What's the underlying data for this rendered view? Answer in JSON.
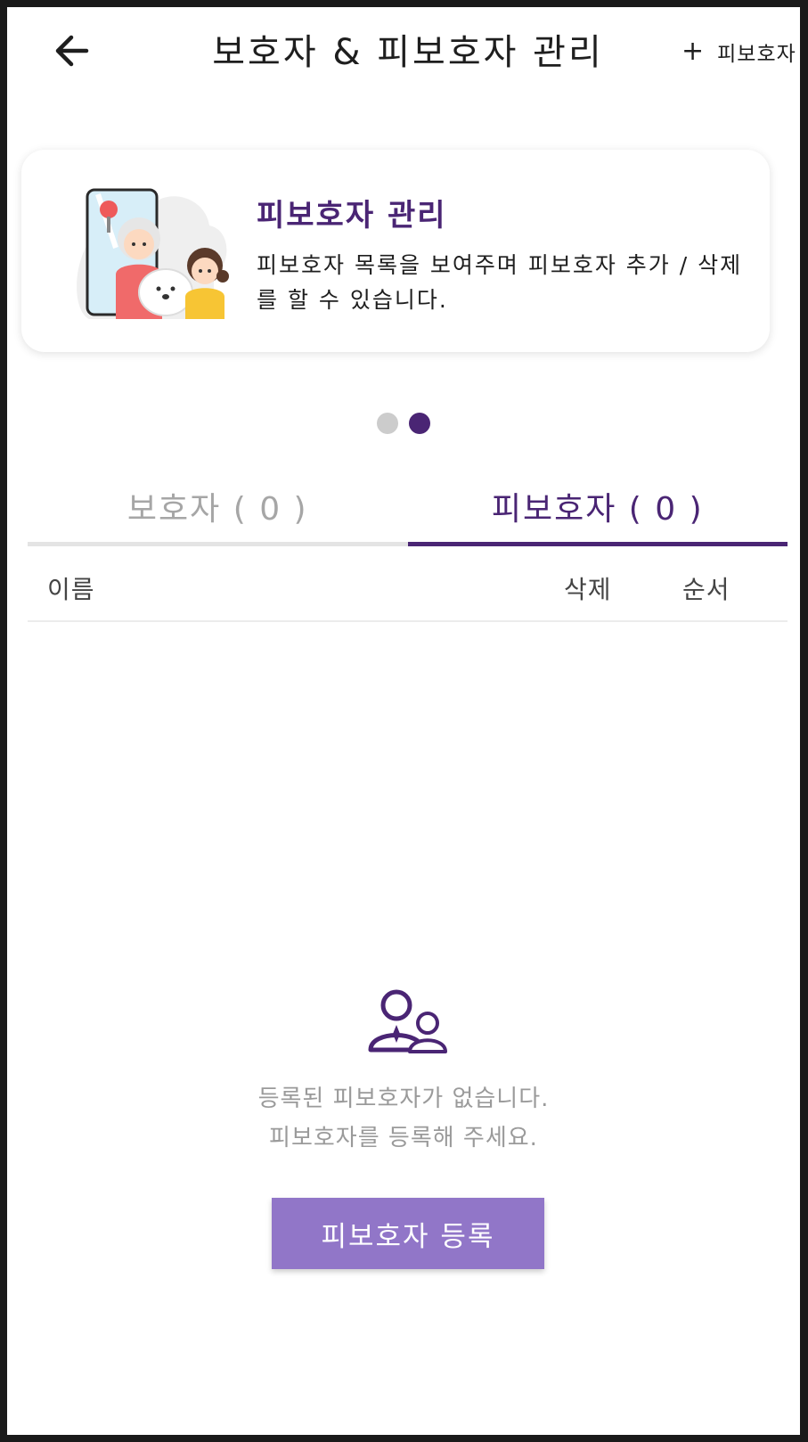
{
  "header": {
    "title": "보호자 & 피보호자 관리",
    "back_icon": "arrow-left-icon",
    "add_icon": "plus-icon",
    "add_label": "피보호자"
  },
  "banner": {
    "title": "피보호자 관리",
    "description": "피보호자 목록을 보여주며 피보호자 추가 / 삭제를 할 수 있습니다.",
    "illustration": "grandma-child-dog-phone-illustration",
    "page_count": 2,
    "active_page": 2
  },
  "tabs": [
    {
      "label": "보호자 ( 0 )",
      "active": false
    },
    {
      "label": "피보호자 ( 0 )",
      "active": true
    }
  ],
  "table": {
    "columns": [
      "이름",
      "삭제",
      "순서"
    ]
  },
  "empty_state": {
    "icon": "guardian-ward-people-icon",
    "line1": "등록된 피보호자가 없습니다.",
    "line2": "피보호자를 등록해 주세요.",
    "button_label": "피보호자 등록"
  },
  "colors": {
    "accent": "#4a2574",
    "button": "#9176c8",
    "inactive_tab": "#a6a6a6",
    "dot_inactive": "#cccccc"
  }
}
